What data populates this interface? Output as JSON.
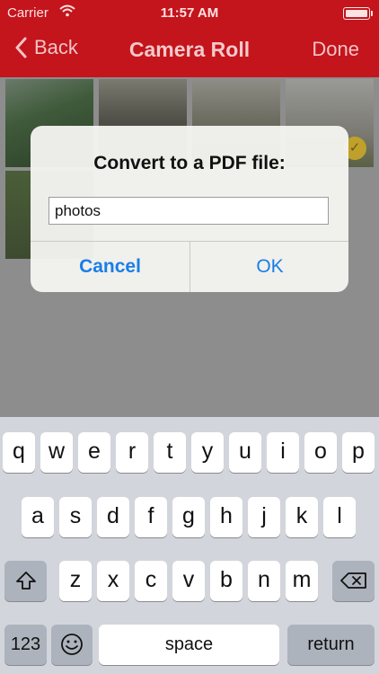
{
  "status": {
    "carrier": "Carrier",
    "time": "11:57 AM"
  },
  "nav": {
    "back_label": "Back",
    "title": "Camera Roll",
    "done_label": "Done"
  },
  "alert": {
    "title": "Convert to a PDF file:",
    "field_value": "photos",
    "cancel_label": "Cancel",
    "ok_label": "OK"
  },
  "keyboard": {
    "row1": [
      "q",
      "w",
      "e",
      "r",
      "t",
      "y",
      "u",
      "i",
      "o",
      "p"
    ],
    "row2": [
      "a",
      "s",
      "d",
      "f",
      "g",
      "h",
      "j",
      "k",
      "l"
    ],
    "row3": [
      "z",
      "x",
      "c",
      "v",
      "b",
      "n",
      "m"
    ],
    "numbers_label": "123",
    "space_label": "space",
    "return_label": "return"
  }
}
